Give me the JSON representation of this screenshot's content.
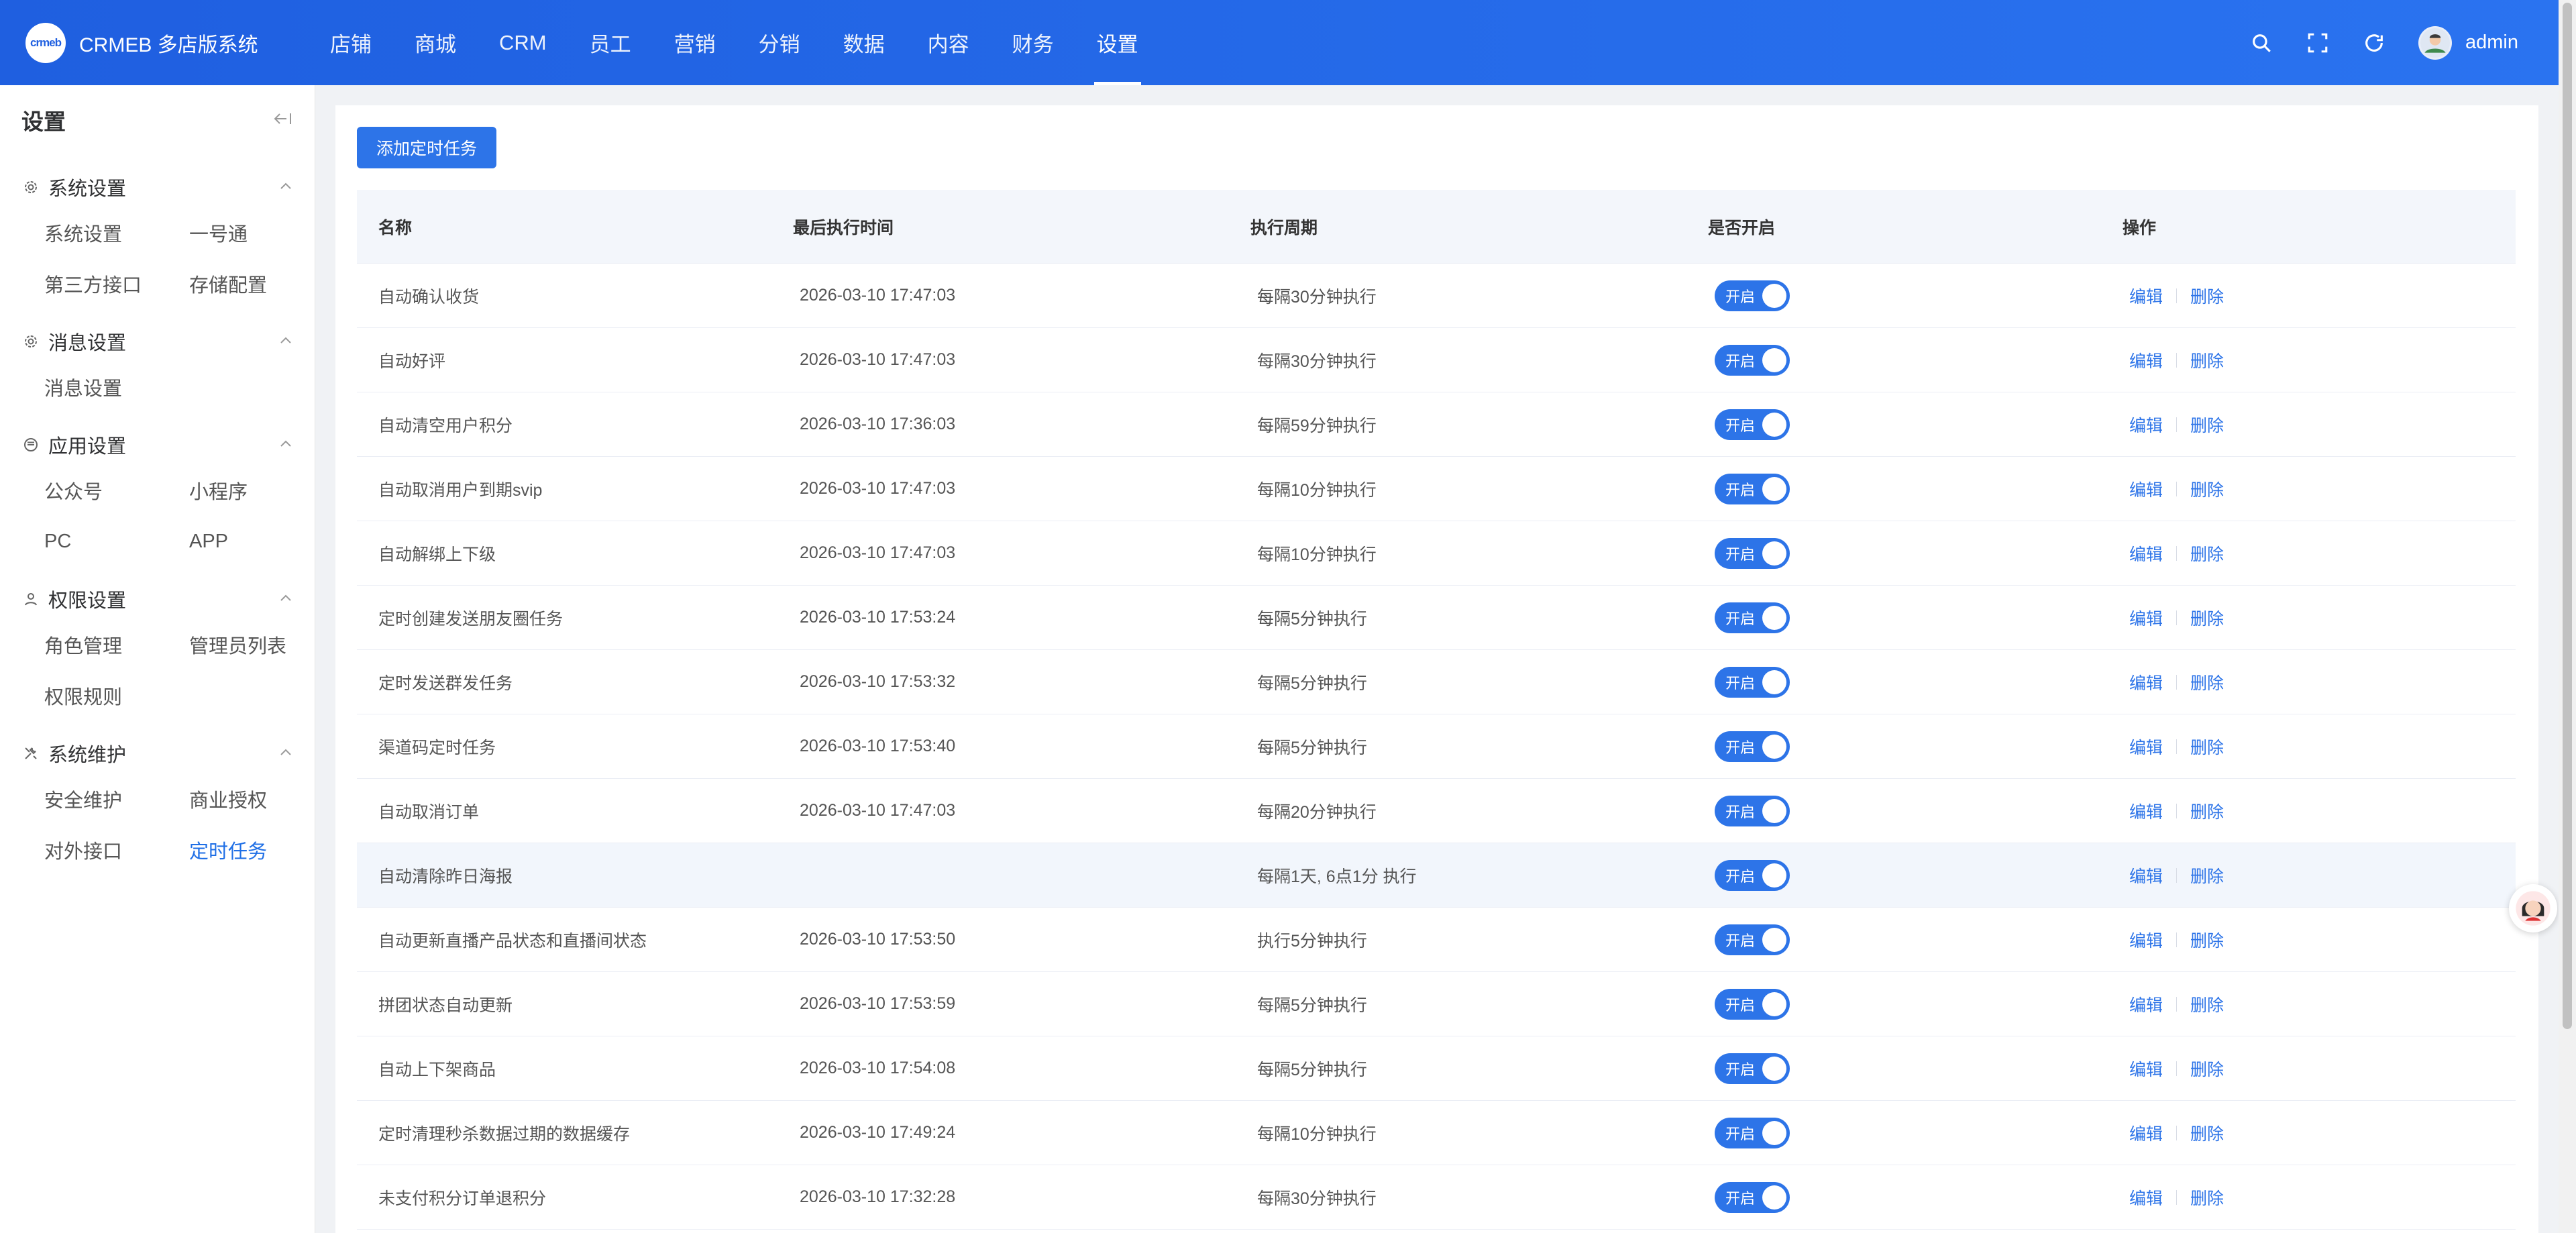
{
  "brand": {
    "logo_text": "crmeb",
    "name": "CRMEB 多店版系统"
  },
  "nav": {
    "items": [
      {
        "label": "店铺"
      },
      {
        "label": "商城"
      },
      {
        "label": "CRM"
      },
      {
        "label": "员工"
      },
      {
        "label": "营销"
      },
      {
        "label": "分销"
      },
      {
        "label": "数据"
      },
      {
        "label": "内容"
      },
      {
        "label": "财务"
      },
      {
        "label": "设置"
      }
    ],
    "active": "设置"
  },
  "user": {
    "name": "admin"
  },
  "sidebar": {
    "title": "设置",
    "groups": [
      {
        "title": "系统设置",
        "icon": "gear-icon",
        "items": [
          "系统设置",
          "一号通",
          "第三方接口",
          "存储配置"
        ]
      },
      {
        "title": "消息设置",
        "icon": "gear-icon",
        "items": [
          "消息设置"
        ]
      },
      {
        "title": "应用设置",
        "icon": "app-icon",
        "items": [
          "公众号",
          "小程序",
          "PC",
          "APP"
        ]
      },
      {
        "title": "权限设置",
        "icon": "user-icon",
        "items": [
          "角色管理",
          "管理员列表",
          "权限规则"
        ]
      },
      {
        "title": "系统维护",
        "icon": "tools-icon",
        "items": [
          "安全维护",
          "商业授权",
          "对外接口",
          "定时任务"
        ]
      }
    ],
    "active_item": "定时任务"
  },
  "toolbar": {
    "add_label": "添加定时任务"
  },
  "table": {
    "headers": {
      "name": "名称",
      "last_run": "最后执行时间",
      "cycle": "执行周期",
      "enabled": "是否开启",
      "ops": "操作"
    },
    "switch_on_label": "开启",
    "edit_label": "编辑",
    "delete_label": "删除",
    "rows": [
      {
        "name": "自动确认收货",
        "last_run": "2026-03-10 17:47:03",
        "cycle": "每隔30分钟执行"
      },
      {
        "name": "自动好评",
        "last_run": "2026-03-10 17:47:03",
        "cycle": "每隔30分钟执行"
      },
      {
        "name": "自动清空用户积分",
        "last_run": "2026-03-10 17:36:03",
        "cycle": "每隔59分钟执行"
      },
      {
        "name": "自动取消用户到期svip",
        "last_run": "2026-03-10 17:47:03",
        "cycle": "每隔10分钟执行"
      },
      {
        "name": "自动解绑上下级",
        "last_run": "2026-03-10 17:47:03",
        "cycle": "每隔10分钟执行"
      },
      {
        "name": "定时创建发送朋友圈任务",
        "last_run": "2026-03-10 17:53:24",
        "cycle": "每隔5分钟执行"
      },
      {
        "name": "定时发送群发任务",
        "last_run": "2026-03-10 17:53:32",
        "cycle": "每隔5分钟执行"
      },
      {
        "name": "渠道码定时任务",
        "last_run": "2026-03-10 17:53:40",
        "cycle": "每隔5分钟执行"
      },
      {
        "name": "自动取消订单",
        "last_run": "2026-03-10 17:47:03",
        "cycle": "每隔20分钟执行"
      },
      {
        "name": "自动清除昨日海报",
        "last_run": "",
        "cycle": "每隔1天, 6点1分 执行"
      },
      {
        "name": "自动更新直播产品状态和直播间状态",
        "last_run": "2026-03-10 17:53:50",
        "cycle": "执行5分钟执行"
      },
      {
        "name": "拼团状态自动更新",
        "last_run": "2026-03-10 17:53:59",
        "cycle": "每隔5分钟执行"
      },
      {
        "name": "自动上下架商品",
        "last_run": "2026-03-10 17:54:08",
        "cycle": "每隔5分钟执行"
      },
      {
        "name": "定时清理秒杀数据过期的数据缓存",
        "last_run": "2026-03-10 17:49:24",
        "cycle": "每隔10分钟执行"
      },
      {
        "name": "未支付积分订单退积分",
        "last_run": "2026-03-10 17:32:28",
        "cycle": "每隔30分钟执行"
      }
    ]
  },
  "colors": {
    "primary": "#2d74e8",
    "topbar": "#1f5fe0"
  }
}
